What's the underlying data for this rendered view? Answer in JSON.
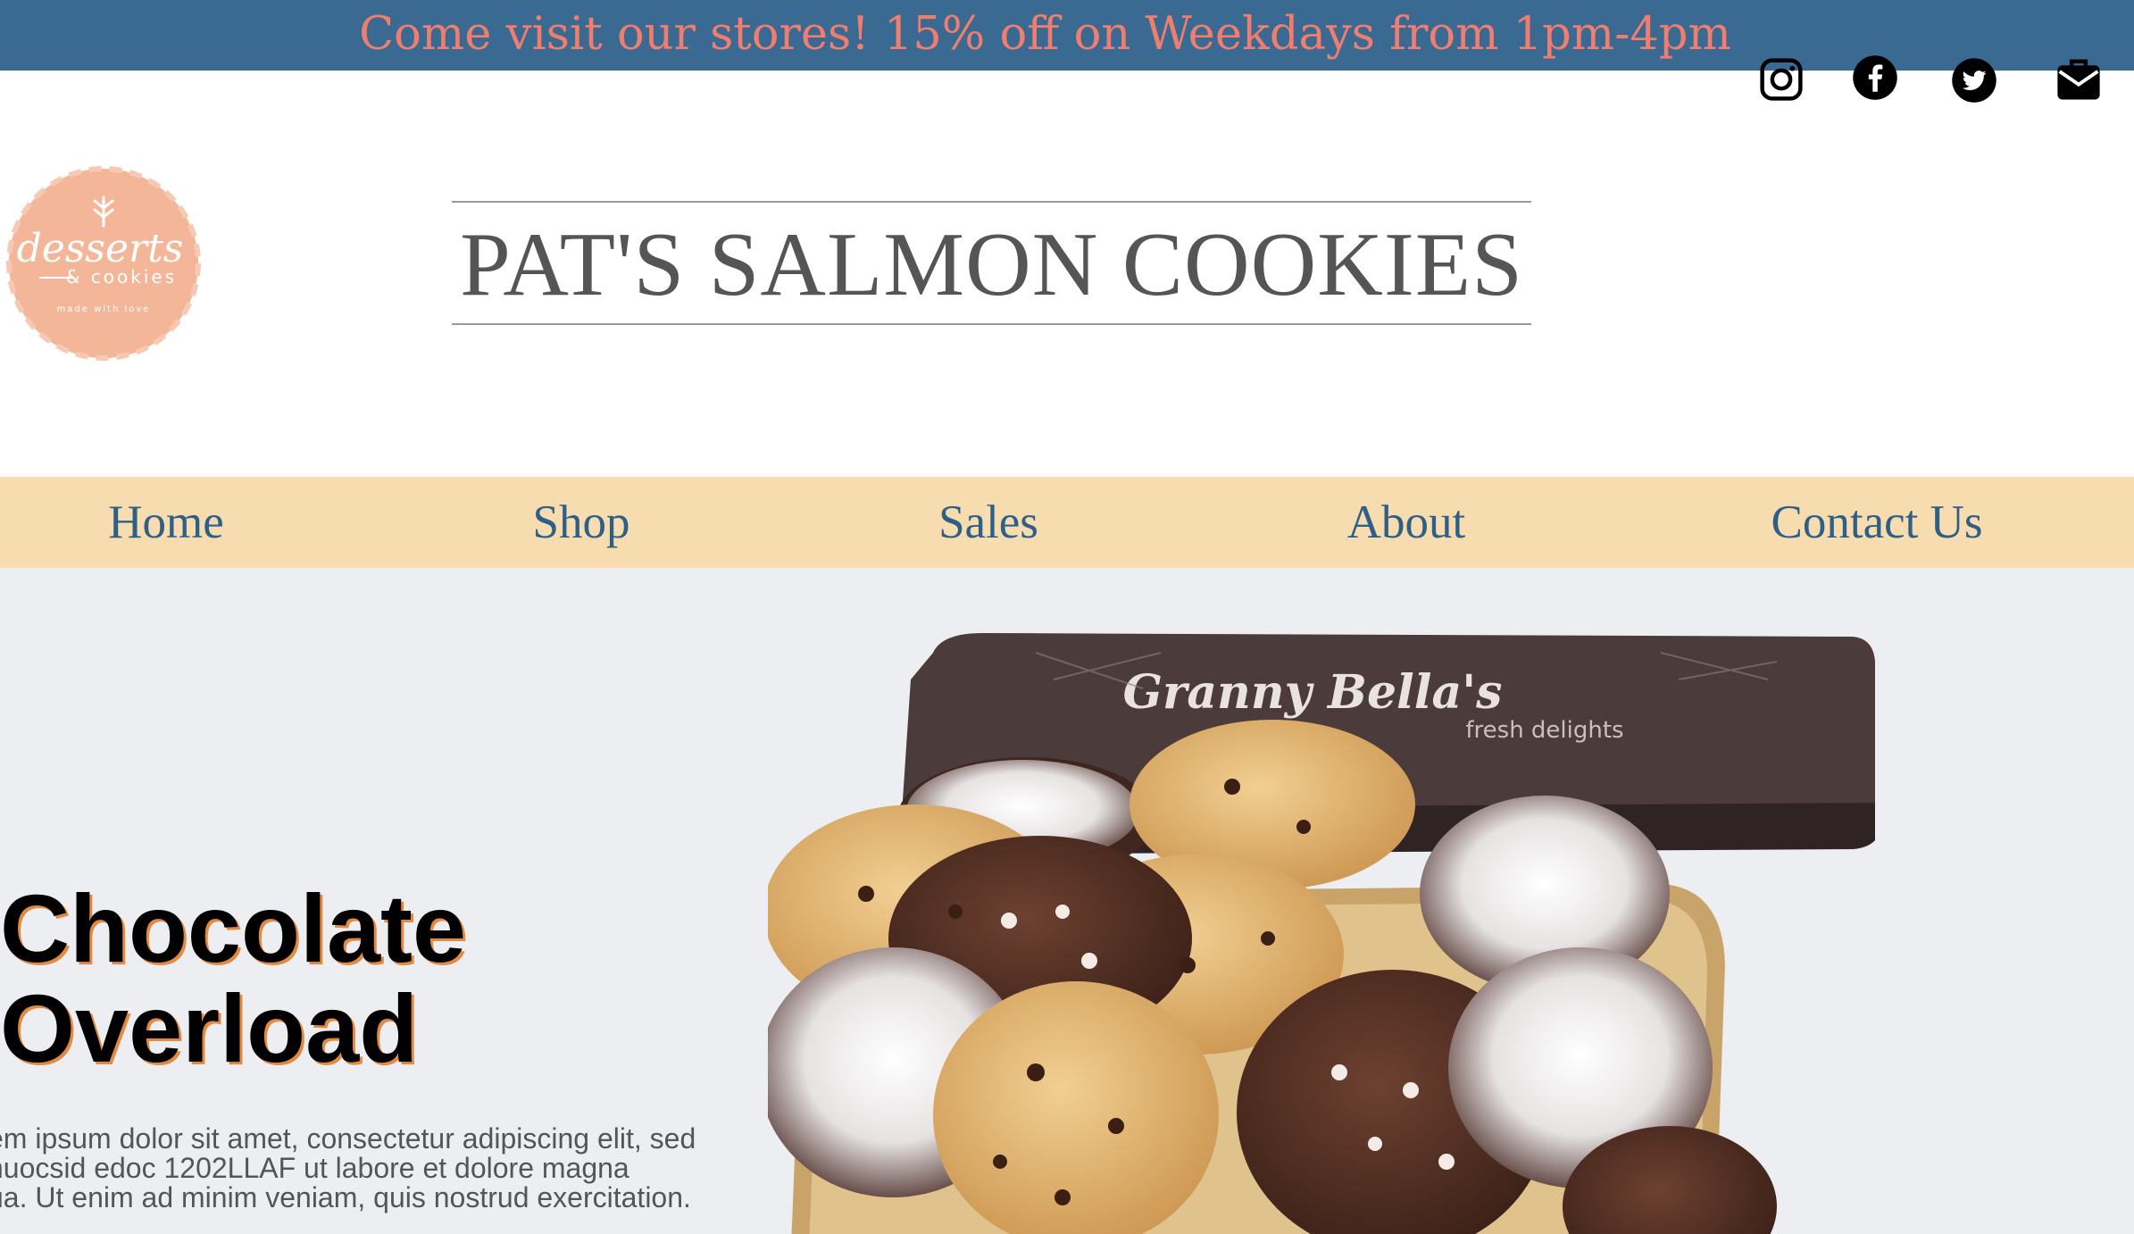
{
  "promo": {
    "text": "Come visit our stores! 15% off on Weekdays from 1pm-4pm"
  },
  "social": [
    {
      "name": "instagram-icon"
    },
    {
      "name": "facebook-icon"
    },
    {
      "name": "twitter-icon"
    },
    {
      "name": "mail-icon"
    }
  ],
  "logo": {
    "icon": "desserts-cookies-logo",
    "line1": "desserts",
    "line2": "& cookies",
    "line3": "made with love"
  },
  "site": {
    "title": "PAT'S SALMON COOKIES"
  },
  "nav": [
    {
      "label": "Home"
    },
    {
      "label": "Shop"
    },
    {
      "label": "Sales"
    },
    {
      "label": "About"
    },
    {
      "label": "Contact Us"
    }
  ],
  "hero": {
    "title_line1": "Chocolate",
    "title_line2": "Overload",
    "body_lines": [
      "em ipsum dolor sit amet, consectetur adipiscing elit, sed",
      "nuocsid edoc 1202LLAF ut labore et dolore magna",
      "ua. Ut enim ad minim veniam, quis nostrud exercitation."
    ],
    "image": {
      "icon": "cookie-tin-image",
      "lid_text": "Granny Bella's",
      "lid_subtext": "fresh delights"
    }
  },
  "colors": {
    "promo_bg": "#3a6991",
    "promo_text": "#f07e6f",
    "nav_bg": "#f7dcb0",
    "nav_text": "#2e5f86",
    "hero_bg": "#edeef1",
    "logo": "#f4b699"
  }
}
